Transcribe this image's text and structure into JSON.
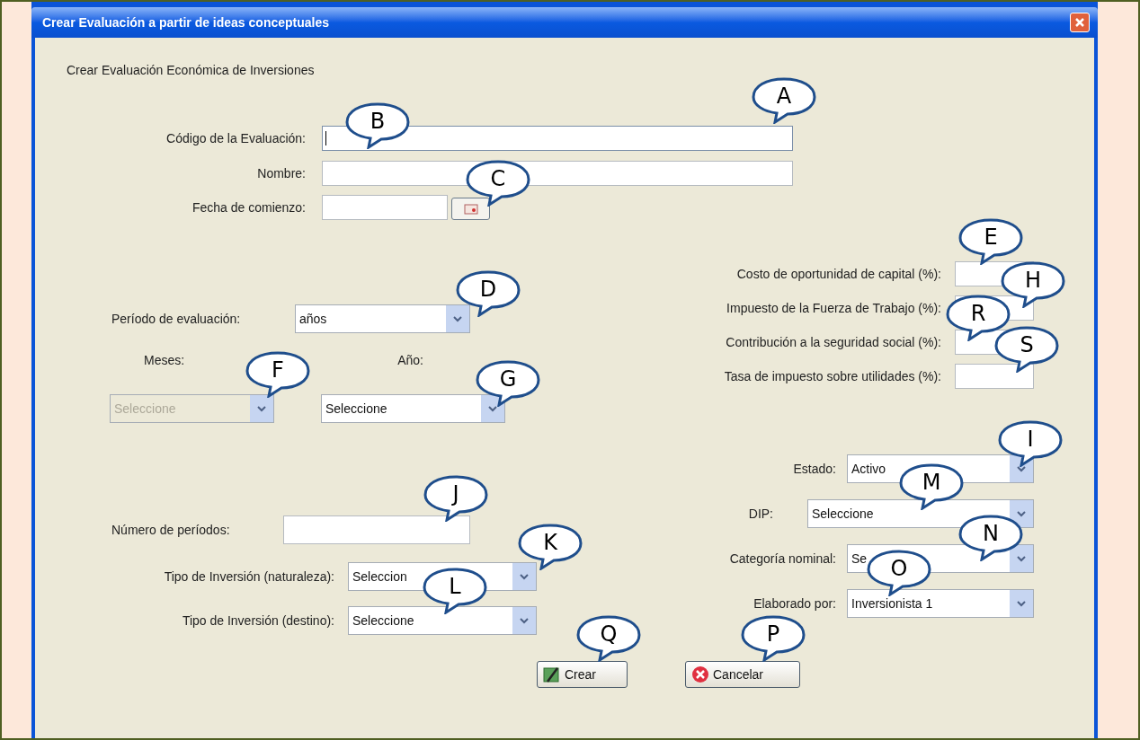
{
  "window": {
    "title": "Crear Evaluación a partir de ideas conceptuales"
  },
  "heading": "Crear Evaluación Económica de Inversiones",
  "top_fields": [
    {
      "label": "Código de la Evaluación:",
      "kind": "text",
      "focused": true
    },
    {
      "label": "Nombre:",
      "kind": "text",
      "focused": false
    },
    {
      "label": "Fecha de comienzo:",
      "kind": "date",
      "focused": false
    }
  ],
  "rates": [
    {
      "label": "Costo de oportunidad de capital (%):"
    },
    {
      "label": "Impuesto de la Fuerza de Trabajo (%):"
    },
    {
      "label": "Contribución a la seguridad social (%):"
    },
    {
      "label": "Tasa de impuesto sobre utilidades (%):"
    }
  ],
  "periodo": {
    "label": "Período de evaluación:",
    "value": "años",
    "disabled": false
  },
  "meses": {
    "label": "Meses:",
    "value": "Seleccione",
    "disabled": true
  },
  "anio": {
    "label": "Año:",
    "value": "Seleccione",
    "disabled": false
  },
  "numero_periodos": {
    "label": "Número de períodos:"
  },
  "tipo_inversion": [
    {
      "label": "Tipo de Inversión (naturaleza):",
      "value": "Seleccion",
      "disabled": false
    },
    {
      "label": "Tipo de Inversión (destino):",
      "value": "Seleccione",
      "disabled": false
    }
  ],
  "right_combos": [
    {
      "label": "Estado:",
      "value": "Activo",
      "disabled": false
    },
    {
      "label": "DIP:",
      "value": "Seleccione",
      "disabled": false
    },
    {
      "label": "Categoría nominal:",
      "value": "Se",
      "disabled": false
    },
    {
      "label": "Elaborado por:",
      "value": "Inversionista 1",
      "disabled": false
    }
  ],
  "buttons": [
    {
      "label": "Crear",
      "kind": "create"
    },
    {
      "label": "Cancelar",
      "kind": "cancel"
    }
  ],
  "callouts": [
    {
      "letter": "A"
    },
    {
      "letter": "B"
    },
    {
      "letter": "C"
    },
    {
      "letter": "E"
    },
    {
      "letter": "D"
    },
    {
      "letter": "H"
    },
    {
      "letter": "R"
    },
    {
      "letter": "S"
    },
    {
      "letter": "F"
    },
    {
      "letter": "G"
    },
    {
      "letter": "I"
    },
    {
      "letter": "J"
    },
    {
      "letter": "M"
    },
    {
      "letter": "K"
    },
    {
      "letter": "N"
    },
    {
      "letter": "L"
    },
    {
      "letter": "O"
    },
    {
      "letter": "Q"
    },
    {
      "letter": "P"
    }
  ]
}
